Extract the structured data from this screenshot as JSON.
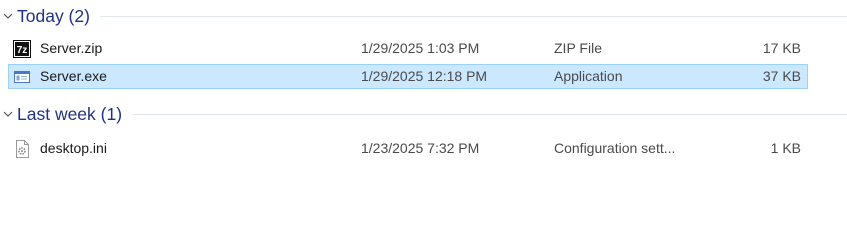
{
  "groups": [
    {
      "title": "Today (2)",
      "files": [
        {
          "icon": "7zip-archive-icon",
          "name": "Server.zip",
          "date": "1/29/2025 1:03 PM",
          "type": "ZIP File",
          "size": "17 KB",
          "selected": false
        },
        {
          "icon": "application-exe-icon",
          "name": "Server.exe",
          "date": "1/29/2025 12:18 PM",
          "type": "Application",
          "size": "37 KB",
          "selected": true
        }
      ]
    },
    {
      "title": "Last week (1)",
      "files": [
        {
          "icon": "config-settings-file-icon",
          "name": "desktop.ini",
          "date": "1/23/2025 7:32 PM",
          "type": "Configuration sett...",
          "size": "1 KB",
          "selected": false
        }
      ]
    }
  ],
  "colors": {
    "group_title": "#1e3287",
    "selection_fill": "#cce8ff",
    "selection_border": "#99d1ff"
  }
}
